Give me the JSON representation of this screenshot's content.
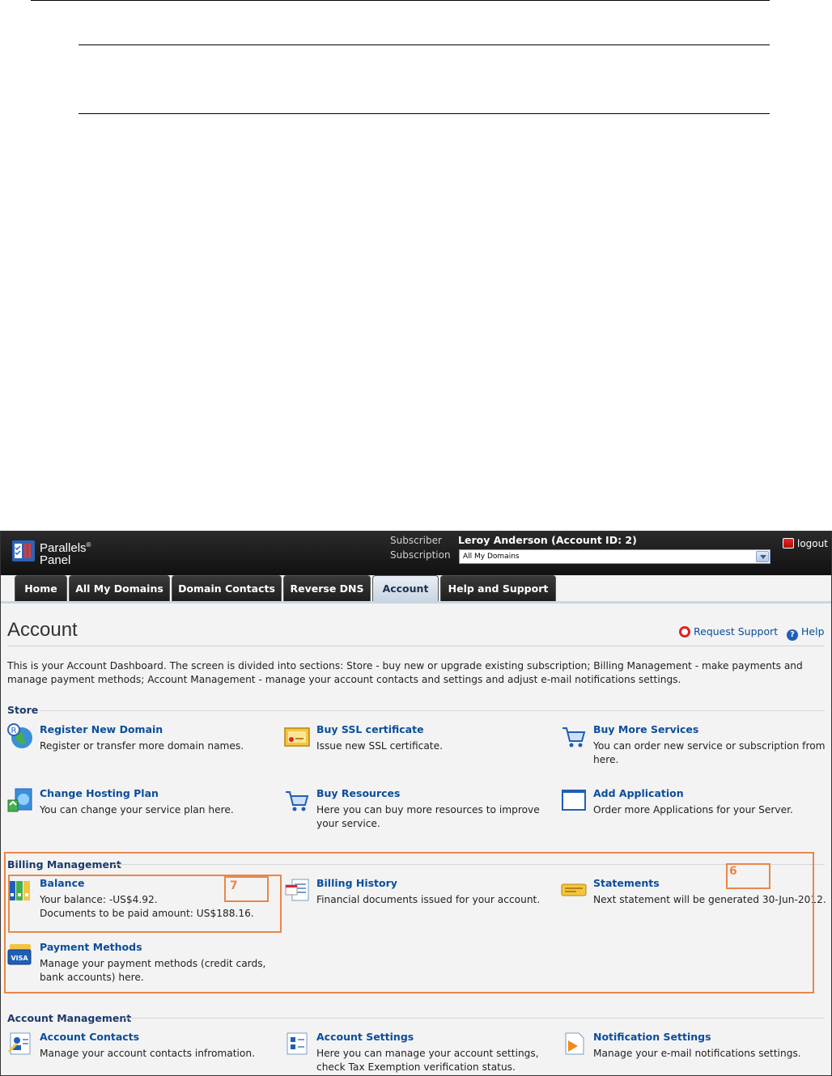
{
  "app": {
    "logo_line1": "Parallels",
    "logo_reg": "®",
    "logo_line2": "Panel",
    "subscriber_label": "Subscriber",
    "subscriber_name": "Leroy Anderson (Account ID: 2)",
    "subscription_label": "Subscription",
    "subscription_value": "All My Domains",
    "logout_label": "logout"
  },
  "tabs": [
    {
      "label": "Home"
    },
    {
      "label": "All My Domains"
    },
    {
      "label": "Domain Contacts"
    },
    {
      "label": "Reverse DNS"
    },
    {
      "label": "Account"
    },
    {
      "label": "Help and Support"
    }
  ],
  "page": {
    "title": "Account",
    "request_support": "Request Support",
    "help": "Help",
    "intro": "This is your Account Dashboard. The screen is divided into sections: Store - buy new or upgrade existing subscription; Billing Management - make payments and manage payment methods; Account Management - manage your account contacts and settings and adjust e-mail notifications settings."
  },
  "store": {
    "heading": "Store",
    "items": [
      {
        "title": "Register New Domain",
        "desc": "Register or transfer more domain names.",
        "icon": "globe-icon"
      },
      {
        "title": "Buy SSL certificate",
        "desc": "Issue new SSL certificate.",
        "icon": "certificate-icon"
      },
      {
        "title": "Buy More Services",
        "desc": "You can order new service or subscription from here.",
        "icon": "cart-icon"
      },
      {
        "title": "Change Hosting Plan",
        "desc": "You can change your service plan here.",
        "icon": "hosting-plan-icon"
      },
      {
        "title": "Buy Resources",
        "desc": "Here you can buy more resources to improve your service.",
        "icon": "cart-icon"
      },
      {
        "title": "Add Application",
        "desc": "Order more Applications for your Server.",
        "icon": "window-icon"
      }
    ]
  },
  "billing": {
    "heading": "Billing Management",
    "items": [
      {
        "title": "Balance",
        "desc1": "Your balance: -US$4.92.",
        "desc2": "Documents to be paid amount: US$188.16.",
        "icon": "binders-icon"
      },
      {
        "title": "Billing History",
        "desc": "Financial documents issued for your account.",
        "icon": "invoice-icon"
      },
      {
        "title": "Statements",
        "desc": "Next statement will be generated 30-Jun-2012.",
        "icon": "statement-icon"
      },
      {
        "title": "Payment Methods",
        "desc": "Manage your payment methods (credit cards, bank accounts) here.",
        "icon": "visa-card-icon"
      }
    ]
  },
  "account_mgmt": {
    "heading": "Account Management",
    "items": [
      {
        "title": "Account Contacts",
        "desc": "Manage your account contacts infromation.",
        "icon": "contacts-icon"
      },
      {
        "title": "Account Settings",
        "desc": "Here you can manage your account settings, check Tax Exemption verification status.",
        "icon": "settings-icon"
      },
      {
        "title": "Notification Settings",
        "desc": "Manage your e-mail notifications settings.",
        "icon": "notification-icon"
      }
    ]
  },
  "annotations": {
    "label_6": "6",
    "label_7": "7"
  },
  "colors": {
    "link": "#0b4d9c",
    "annotation": "#e8874a",
    "topbar": "#1a1a1a"
  }
}
